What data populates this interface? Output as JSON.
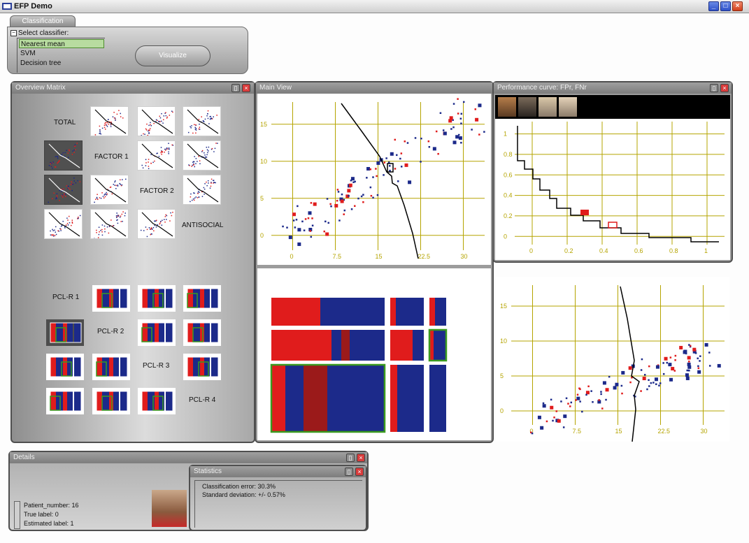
{
  "window": {
    "title": "EFP Demo",
    "buttons": [
      "minimize",
      "maximize",
      "close"
    ]
  },
  "tabs": [
    {
      "label": "Classification",
      "active": true
    }
  ],
  "classifier": {
    "heading": "Select classifier:",
    "options": [
      "Nearest mean",
      "SVM",
      "Decision tree"
    ],
    "selected": "Nearest mean",
    "visualize_label": "Visualize"
  },
  "overview_matrix": {
    "title": "Overview Matrix",
    "factor_labels": [
      "TOTAL",
      "FACTOR 1",
      "FACTOR 2",
      "ANTISOCIAL"
    ],
    "pcl_labels": [
      "PCL-R 1",
      "PCL-R 2",
      "PCL-R 3",
      "PCL-R 4"
    ]
  },
  "main_view": {
    "title": "Main View",
    "x_ticks": [
      "0",
      "7.5",
      "15",
      "22.5",
      "30"
    ],
    "y_ticks": [
      "15",
      "10",
      "5",
      "0"
    ]
  },
  "performance_curve": {
    "title": "Performance curve: FPr, FNr",
    "x_ticks": [
      "0",
      "0.2",
      "0.4",
      "0.6",
      "0.8",
      "1"
    ],
    "y_ticks": [
      "1",
      "0.8",
      "0.6",
      "0.4",
      "0.2",
      "0"
    ]
  },
  "lower_scatter": {
    "x_ticks": [
      "0",
      "7.5",
      "15",
      "22.5",
      "30"
    ],
    "y_ticks": [
      "15",
      "10",
      "5",
      "0"
    ]
  },
  "details": {
    "title": "Details",
    "lines": [
      "Patient_number: 16",
      "True label: 0",
      "Estimated label: 1"
    ]
  },
  "statistics": {
    "title": "Statistics",
    "lines": [
      "Classification error: 30.3%",
      "Standard deviation: +/- 0.57%"
    ]
  },
  "colors": {
    "class_red": "#e01c1c",
    "class_blue": "#1c2a8a",
    "grid": "#b5a400",
    "selection": "#3a9a1f"
  }
}
